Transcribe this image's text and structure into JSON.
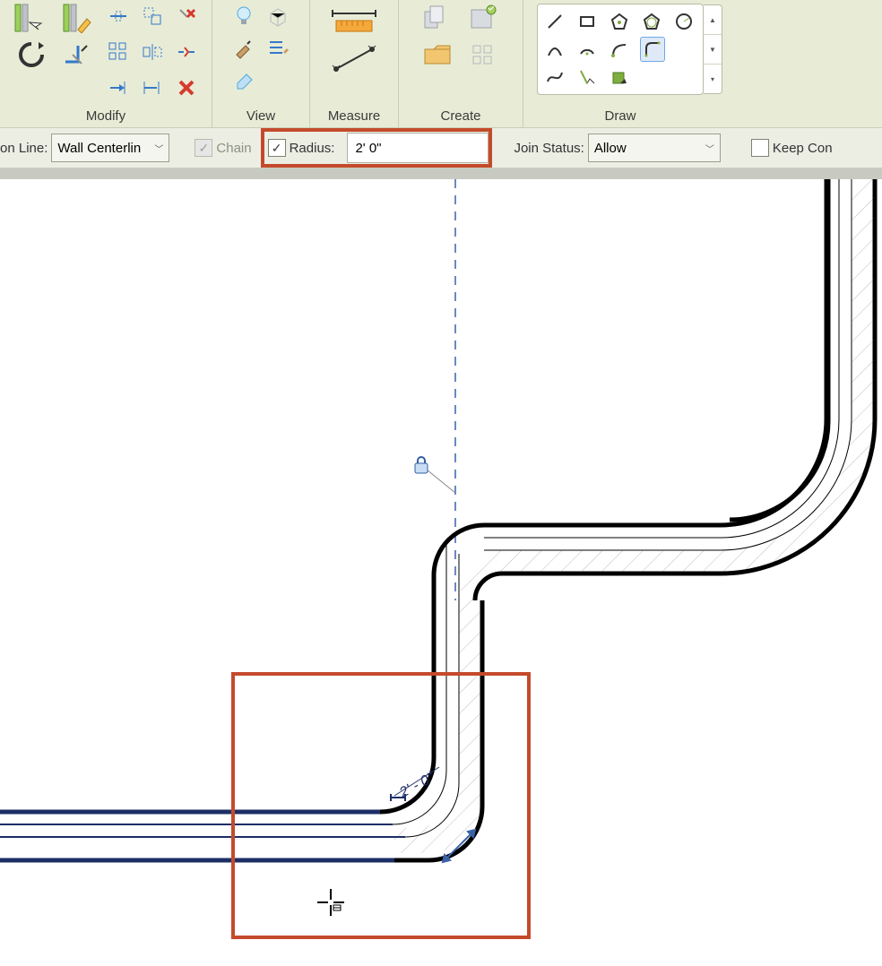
{
  "ribbon": {
    "panels": {
      "modify": {
        "label": "Modify"
      },
      "view": {
        "label": "View"
      },
      "measure": {
        "label": "Measure"
      },
      "create": {
        "label": "Create"
      },
      "draw": {
        "label": "Draw"
      }
    }
  },
  "options": {
    "location_line_label": "on Line:",
    "location_line_value": "Wall Centerlin",
    "chain_label": "Chain",
    "chain_checked": true,
    "radius_label": "Radius:",
    "radius_checked": true,
    "radius_value": "2'  0\"",
    "join_status_label": "Join Status:",
    "join_status_value": "Allow",
    "keep_label": "Keep Con"
  },
  "canvas": {
    "dimension_text": "2' - 0\"",
    "lock_icon": "lock-icon"
  }
}
